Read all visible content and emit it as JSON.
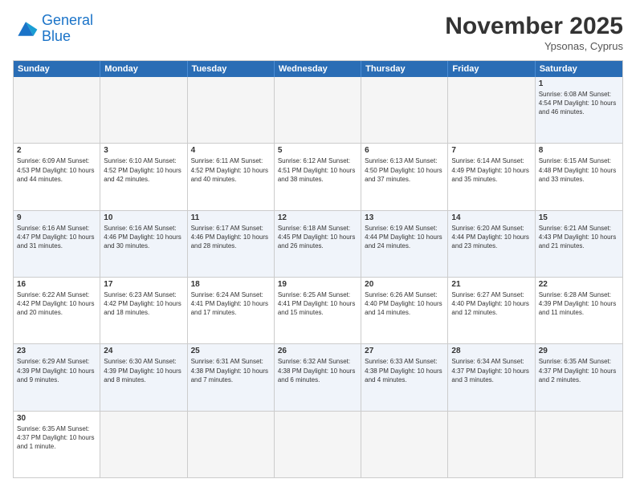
{
  "header": {
    "logo_general": "General",
    "logo_blue": "Blue",
    "month_title": "November 2025",
    "subtitle": "Ypsonas, Cyprus"
  },
  "weekdays": [
    "Sunday",
    "Monday",
    "Tuesday",
    "Wednesday",
    "Thursday",
    "Friday",
    "Saturday"
  ],
  "rows": [
    [
      {
        "day": "",
        "info": ""
      },
      {
        "day": "",
        "info": ""
      },
      {
        "day": "",
        "info": ""
      },
      {
        "day": "",
        "info": ""
      },
      {
        "day": "",
        "info": ""
      },
      {
        "day": "",
        "info": ""
      },
      {
        "day": "1",
        "info": "Sunrise: 6:08 AM\nSunset: 4:54 PM\nDaylight: 10 hours and 46 minutes."
      }
    ],
    [
      {
        "day": "2",
        "info": "Sunrise: 6:09 AM\nSunset: 4:53 PM\nDaylight: 10 hours and 44 minutes."
      },
      {
        "day": "3",
        "info": "Sunrise: 6:10 AM\nSunset: 4:52 PM\nDaylight: 10 hours and 42 minutes."
      },
      {
        "day": "4",
        "info": "Sunrise: 6:11 AM\nSunset: 4:52 PM\nDaylight: 10 hours and 40 minutes."
      },
      {
        "day": "5",
        "info": "Sunrise: 6:12 AM\nSunset: 4:51 PM\nDaylight: 10 hours and 38 minutes."
      },
      {
        "day": "6",
        "info": "Sunrise: 6:13 AM\nSunset: 4:50 PM\nDaylight: 10 hours and 37 minutes."
      },
      {
        "day": "7",
        "info": "Sunrise: 6:14 AM\nSunset: 4:49 PM\nDaylight: 10 hours and 35 minutes."
      },
      {
        "day": "8",
        "info": "Sunrise: 6:15 AM\nSunset: 4:48 PM\nDaylight: 10 hours and 33 minutes."
      }
    ],
    [
      {
        "day": "9",
        "info": "Sunrise: 6:16 AM\nSunset: 4:47 PM\nDaylight: 10 hours and 31 minutes."
      },
      {
        "day": "10",
        "info": "Sunrise: 6:16 AM\nSunset: 4:46 PM\nDaylight: 10 hours and 30 minutes."
      },
      {
        "day": "11",
        "info": "Sunrise: 6:17 AM\nSunset: 4:46 PM\nDaylight: 10 hours and 28 minutes."
      },
      {
        "day": "12",
        "info": "Sunrise: 6:18 AM\nSunset: 4:45 PM\nDaylight: 10 hours and 26 minutes."
      },
      {
        "day": "13",
        "info": "Sunrise: 6:19 AM\nSunset: 4:44 PM\nDaylight: 10 hours and 24 minutes."
      },
      {
        "day": "14",
        "info": "Sunrise: 6:20 AM\nSunset: 4:44 PM\nDaylight: 10 hours and 23 minutes."
      },
      {
        "day": "15",
        "info": "Sunrise: 6:21 AM\nSunset: 4:43 PM\nDaylight: 10 hours and 21 minutes."
      }
    ],
    [
      {
        "day": "16",
        "info": "Sunrise: 6:22 AM\nSunset: 4:42 PM\nDaylight: 10 hours and 20 minutes."
      },
      {
        "day": "17",
        "info": "Sunrise: 6:23 AM\nSunset: 4:42 PM\nDaylight: 10 hours and 18 minutes."
      },
      {
        "day": "18",
        "info": "Sunrise: 6:24 AM\nSunset: 4:41 PM\nDaylight: 10 hours and 17 minutes."
      },
      {
        "day": "19",
        "info": "Sunrise: 6:25 AM\nSunset: 4:41 PM\nDaylight: 10 hours and 15 minutes."
      },
      {
        "day": "20",
        "info": "Sunrise: 6:26 AM\nSunset: 4:40 PM\nDaylight: 10 hours and 14 minutes."
      },
      {
        "day": "21",
        "info": "Sunrise: 6:27 AM\nSunset: 4:40 PM\nDaylight: 10 hours and 12 minutes."
      },
      {
        "day": "22",
        "info": "Sunrise: 6:28 AM\nSunset: 4:39 PM\nDaylight: 10 hours and 11 minutes."
      }
    ],
    [
      {
        "day": "23",
        "info": "Sunrise: 6:29 AM\nSunset: 4:39 PM\nDaylight: 10 hours and 9 minutes."
      },
      {
        "day": "24",
        "info": "Sunrise: 6:30 AM\nSunset: 4:39 PM\nDaylight: 10 hours and 8 minutes."
      },
      {
        "day": "25",
        "info": "Sunrise: 6:31 AM\nSunset: 4:38 PM\nDaylight: 10 hours and 7 minutes."
      },
      {
        "day": "26",
        "info": "Sunrise: 6:32 AM\nSunset: 4:38 PM\nDaylight: 10 hours and 6 minutes."
      },
      {
        "day": "27",
        "info": "Sunrise: 6:33 AM\nSunset: 4:38 PM\nDaylight: 10 hours and 4 minutes."
      },
      {
        "day": "28",
        "info": "Sunrise: 6:34 AM\nSunset: 4:37 PM\nDaylight: 10 hours and 3 minutes."
      },
      {
        "day": "29",
        "info": "Sunrise: 6:35 AM\nSunset: 4:37 PM\nDaylight: 10 hours and 2 minutes."
      }
    ],
    [
      {
        "day": "30",
        "info": "Sunrise: 6:35 AM\nSunset: 4:37 PM\nDaylight: 10 hours and 1 minute."
      },
      {
        "day": "",
        "info": ""
      },
      {
        "day": "",
        "info": ""
      },
      {
        "day": "",
        "info": ""
      },
      {
        "day": "",
        "info": ""
      },
      {
        "day": "",
        "info": ""
      },
      {
        "day": "",
        "info": ""
      }
    ]
  ]
}
